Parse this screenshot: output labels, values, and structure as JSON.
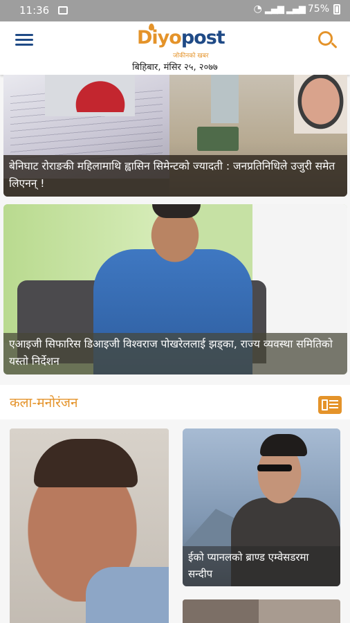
{
  "status_bar": {
    "time": "11:36",
    "battery": "75%"
  },
  "header": {
    "logo_main_a": "Diyo",
    "logo_main_b": "post",
    "logo_tagline": "जोकीनको खबर",
    "date": "बिहिबार, मंसिर २५, २०७७",
    "menu_icon": "hamburger-icon",
    "search_icon": "search-icon"
  },
  "featured": [
    {
      "caption": "बेनिघाट रोराङकी महिलामाथि ह्वासिन सिमेन्टको ज्यादती : जनप्रतिनिधिले उजुरी समेत लिएनन् !"
    },
    {
      "caption": "एआइजी सिफारिस डिआइजी विश्वराज पोखरेललाई झड्का, राज्य व्यवस्था समितिको यस्तो निर्देशन"
    }
  ],
  "section": {
    "title": "कला-मनोरंजन",
    "icon": "list-view-icon"
  },
  "grid": [
    {
      "caption": ""
    },
    {
      "caption": "ईको प्यानलको ब्राण्ड एम्वेसडरमा सन्दीप"
    }
  ],
  "colors": {
    "accent": "#e4932a",
    "brand_blue": "#1f4a86",
    "status_bar": "#9e9e9e"
  }
}
